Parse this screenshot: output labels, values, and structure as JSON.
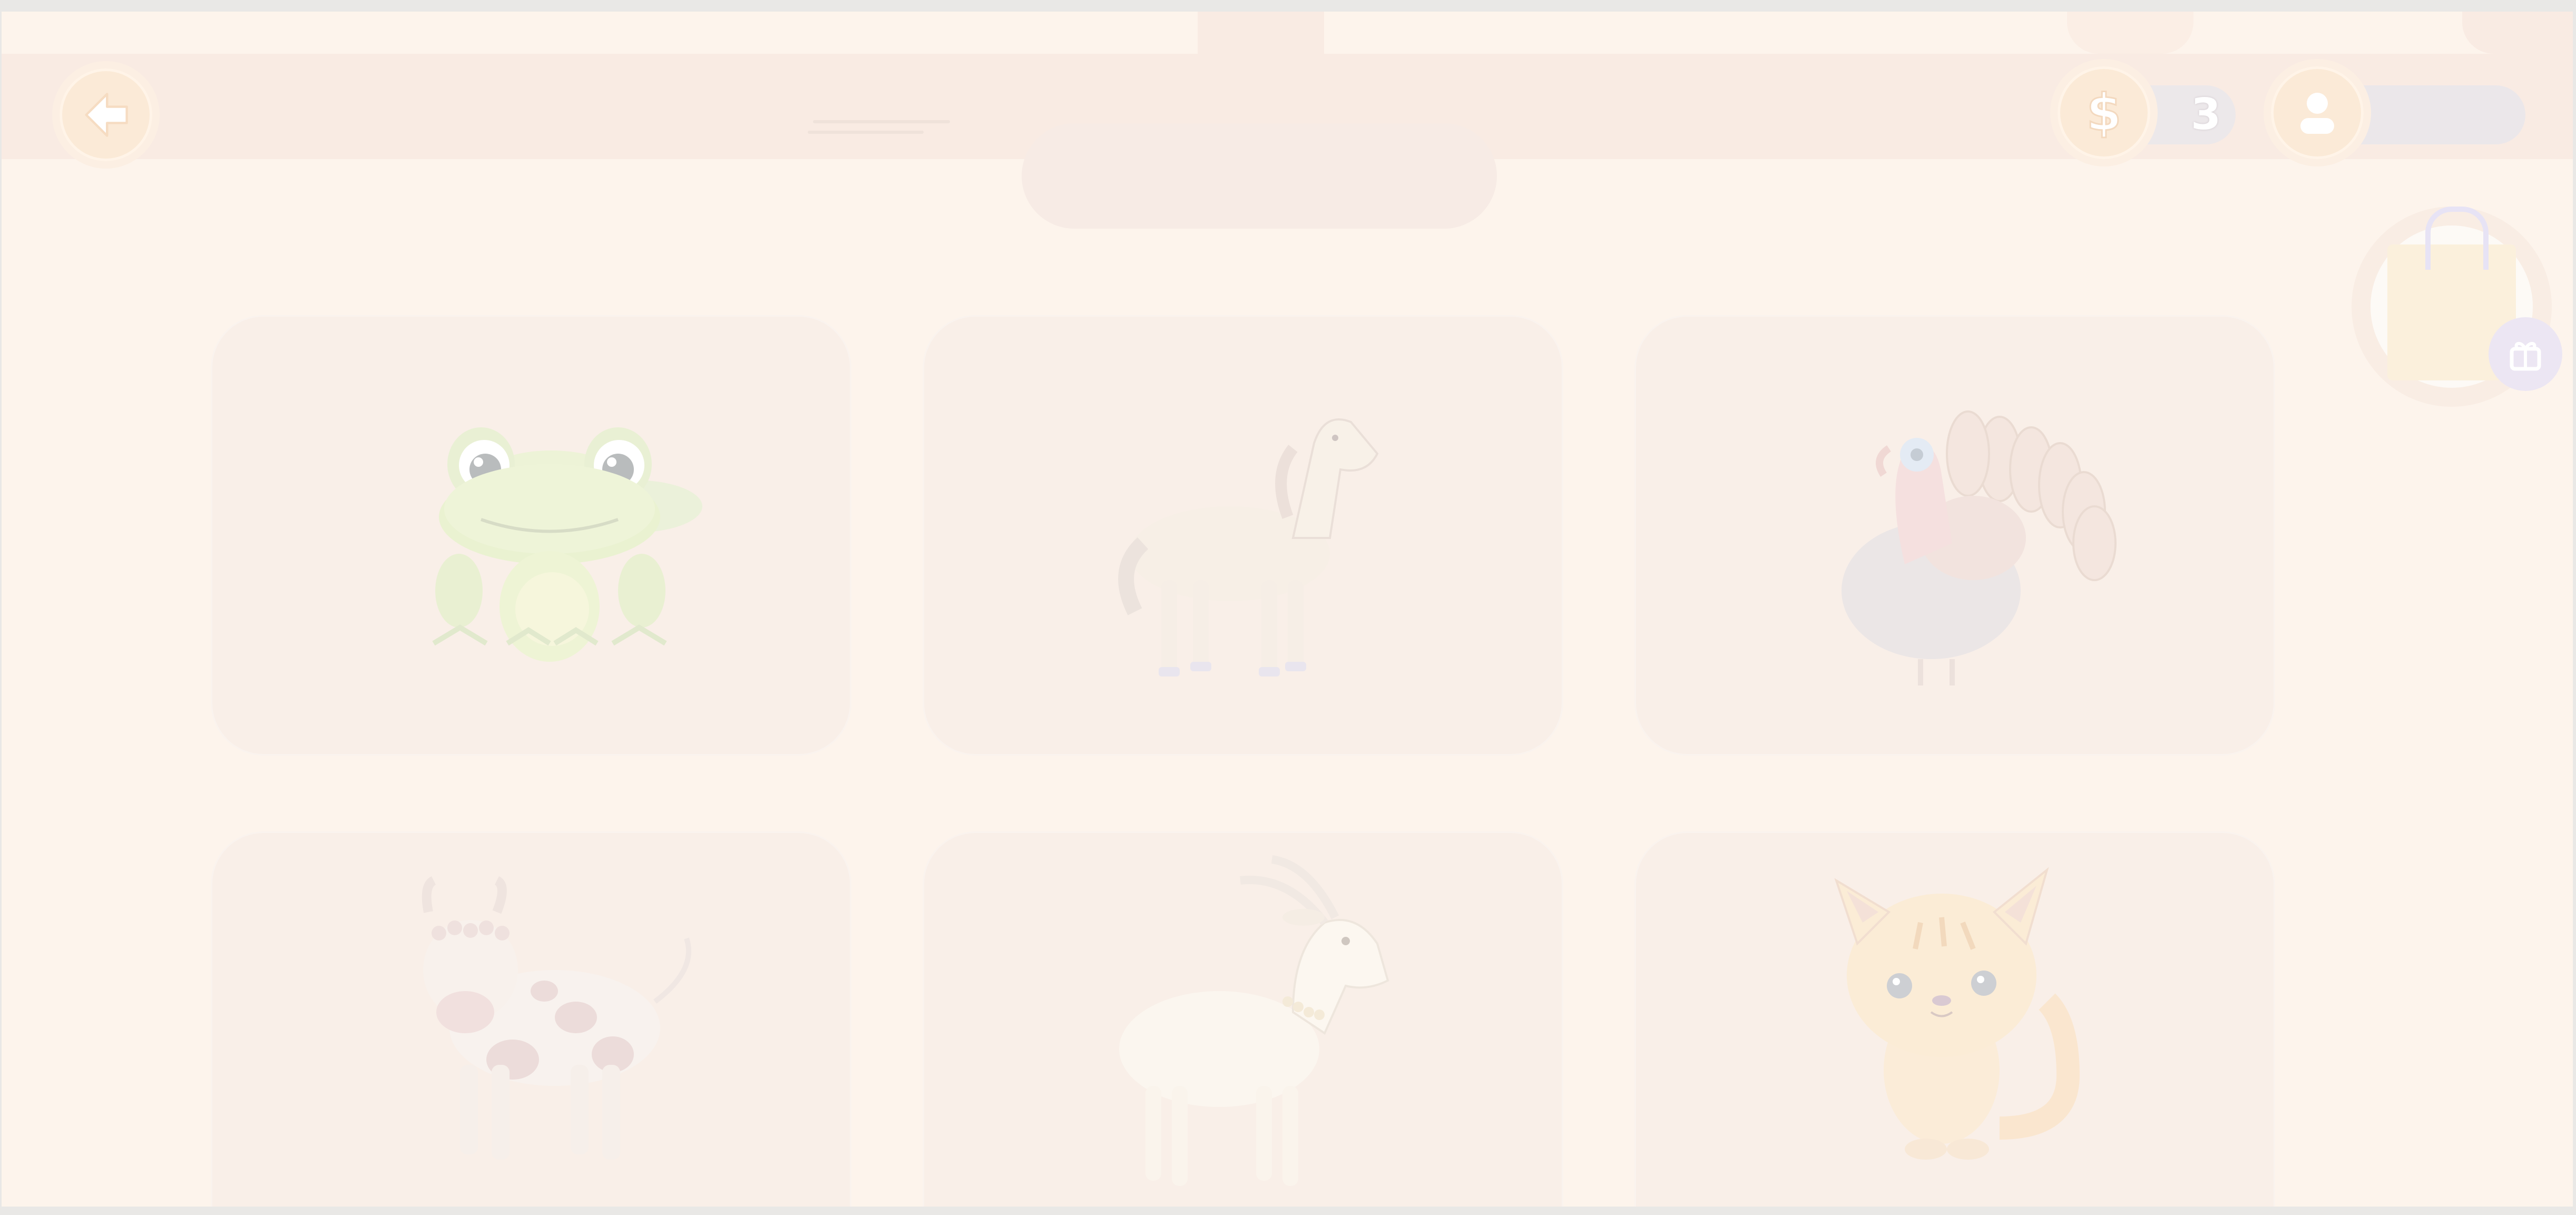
{
  "header": {
    "back_icon": "arrow-left-icon",
    "coins": {
      "icon": "dollar-coin-icon",
      "count": "3"
    },
    "profile": {
      "icon": "user-icon",
      "name": ""
    },
    "title": ""
  },
  "shop": {
    "icon": "shopping-bag-icon",
    "badge_icon": "gift-icon"
  },
  "cards": [
    {
      "animal": "frog"
    },
    {
      "animal": "horse"
    },
    {
      "animal": "turkey"
    },
    {
      "animal": "cow"
    },
    {
      "animal": "goat"
    },
    {
      "animal": "cat"
    }
  ],
  "colors": {
    "background": "#fdf4ec",
    "card": "#f9efe8",
    "topbar": "#f9ebe3",
    "pill": "#ece8ea"
  }
}
